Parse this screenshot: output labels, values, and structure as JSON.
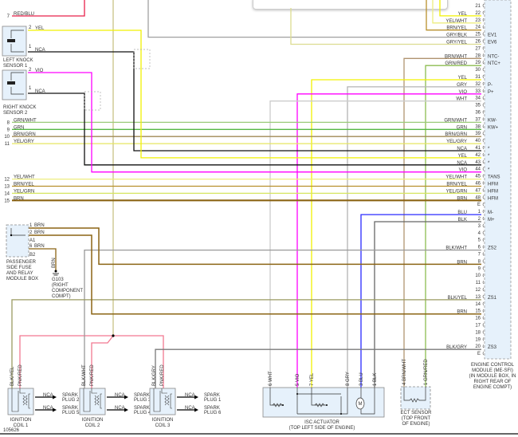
{
  "diagram_id": "105626",
  "ecm": {
    "label": [
      "ENGINE CONTROL",
      "MODULE (ME-SFI)",
      "(IN MODULE BOX, IN",
      "RIGHT REAR OF",
      "ENGINE COMPT)"
    ],
    "pins": [
      {
        "pin": "21",
        "wire": "",
        "func": "",
        "color": ""
      },
      {
        "pin": "22",
        "wire": "YEL",
        "func": "",
        "color": "#f2f200"
      },
      {
        "pin": "23",
        "wire": "YEL/WHT",
        "func": "",
        "color": "#eeee80"
      },
      {
        "pin": "24",
        "wire": "BRN/YEL",
        "func": "",
        "color": "#b8902c"
      },
      {
        "pin": "25",
        "wire": "GRY/BLK",
        "func": "EV1",
        "color": "#a0a0a0"
      },
      {
        "pin": "26",
        "wire": "GRY/YEL",
        "func": "EV6",
        "color": "#dcdc90"
      },
      {
        "pin": "27",
        "wire": "",
        "func": "",
        "color": ""
      },
      {
        "pin": "28",
        "wire": "BRN/WHT",
        "func": "NTC-",
        "color": "#b09470"
      },
      {
        "pin": "29",
        "wire": "GRN/RED",
        "func": "NTC+",
        "color": "#8cbc50"
      },
      {
        "pin": "30",
        "wire": "",
        "func": "",
        "color": ""
      },
      {
        "pin": "31",
        "wire": "YEL",
        "func": "",
        "color": "#f2f200"
      },
      {
        "pin": "32",
        "wire": "GRY",
        "func": "P-",
        "color": "#b4b4b4"
      },
      {
        "pin": "33",
        "wire": "VIO",
        "func": "P+",
        "color": "#ff00ff"
      },
      {
        "pin": "34",
        "wire": "WHT",
        "func": "",
        "color": "#cccccc"
      },
      {
        "pin": "35",
        "wire": "",
        "func": "",
        "color": ""
      },
      {
        "pin": "36",
        "wire": "",
        "func": "",
        "color": ""
      },
      {
        "pin": "37",
        "wire": "GRN/WHT",
        "func": "KW-",
        "color": "#9acb78"
      },
      {
        "pin": "38",
        "wire": "GRN",
        "func": "KW+",
        "color": "#55b845"
      },
      {
        "pin": "39",
        "wire": "BRN/GRN",
        "func": "",
        "color": "#a08a55"
      },
      {
        "pin": "40",
        "wire": "YEL/GRY",
        "func": "",
        "color": "#e6e660"
      },
      {
        "pin": "41",
        "wire": "NCA",
        "func": "*",
        "color": "#111111"
      },
      {
        "pin": "42",
        "wire": "YEL",
        "func": "*",
        "color": "#f2f200"
      },
      {
        "pin": "43",
        "wire": "NCA",
        "func": "*",
        "color": "#111111"
      },
      {
        "pin": "44",
        "wire": "VIO",
        "func": "*",
        "color": "#ff00ff"
      },
      {
        "pin": "45",
        "wire": "YEL/WHT",
        "func": "TANS",
        "color": "#eeee80"
      },
      {
        "pin": "46",
        "wire": "BRN/YEL",
        "func": "HFM",
        "color": "#b8902c"
      },
      {
        "pin": "47",
        "wire": "YEL/GRN",
        "func": "HFM",
        "color": "#d6e660"
      },
      {
        "pin": "48",
        "wire": "BRN",
        "func": "HFM",
        "color": "#8b6414"
      },
      {
        "pin": "E",
        "wire": "",
        "func": "",
        "color": ""
      },
      {
        "pin": "1",
        "wire": "BLU",
        "func": "M-",
        "color": "#2a2aff"
      },
      {
        "pin": "2",
        "wire": "BLK",
        "func": "M+",
        "color": "#666666"
      },
      {
        "pin": "3",
        "wire": "",
        "func": "",
        "color": ""
      },
      {
        "pin": "4",
        "wire": "",
        "func": "",
        "color": ""
      },
      {
        "pin": "5",
        "wire": "",
        "func": "",
        "color": ""
      },
      {
        "pin": "6",
        "wire": "BLK/WHT",
        "func": "ZS2",
        "color": "#999999"
      },
      {
        "pin": "7",
        "wire": "",
        "func": "",
        "color": ""
      },
      {
        "pin": "8",
        "wire": "BRN",
        "func": "",
        "color": "#8b6414"
      },
      {
        "pin": "9",
        "wire": "",
        "func": "",
        "color": ""
      },
      {
        "pin": "10",
        "wire": "",
        "func": "",
        "color": ""
      },
      {
        "pin": "11",
        "wire": "",
        "func": "",
        "color": ""
      },
      {
        "pin": "12",
        "wire": "",
        "func": "",
        "color": ""
      },
      {
        "pin": "13",
        "wire": "BLK/YEL",
        "func": "ZS1",
        "color": "#9a9a60"
      },
      {
        "pin": "14",
        "wire": "",
        "func": "",
        "color": ""
      },
      {
        "pin": "15",
        "wire": "BRN",
        "func": "",
        "color": "#8b6414"
      },
      {
        "pin": "16",
        "wire": "",
        "func": "",
        "color": ""
      },
      {
        "pin": "17",
        "wire": "",
        "func": "",
        "color": ""
      },
      {
        "pin": "18",
        "wire": "",
        "func": "",
        "color": ""
      },
      {
        "pin": "19",
        "wire": "",
        "func": "",
        "color": ""
      },
      {
        "pin": "20",
        "wire": "BLK/GRY",
        "func": "ZS3",
        "color": "#7a7a7a"
      },
      {
        "pin": "E",
        "wire": "",
        "func": "",
        "color": ""
      }
    ]
  },
  "left_connector": [
    {
      "pin": "7",
      "wire": "RED/BLU",
      "color": "#e8204a"
    },
    {
      "pin": "8",
      "wire": "GRN/WHT"
    },
    {
      "pin": "9",
      "wire": "GRN"
    },
    {
      "pin": "10",
      "wire": "BRN/GRN"
    },
    {
      "pin": "11",
      "wire": "YEL/GRY"
    },
    {
      "pin": "12",
      "wire": "YEL/WHT"
    },
    {
      "pin": "13",
      "wire": "BRN/YEL"
    },
    {
      "pin": "14",
      "wire": "YEL/GRN"
    },
    {
      "pin": "15",
      "wire": "BRN"
    }
  ],
  "knock_left": {
    "label": [
      "LEFT KNOCK",
      "SENSOR 1"
    ],
    "pin2": "2",
    "wire2": "YEL",
    "pin1": "1",
    "wire1": "NCA"
  },
  "knock_right": {
    "label": [
      "RIGHT KNOCK",
      "SENSOR 2"
    ],
    "pin2": "2",
    "wire2": "VIO",
    "pin1": "1",
    "wire1": "NCA"
  },
  "fuse_box": {
    "label": [
      "PASSENGER",
      "SIDE FUSE",
      "AND RELAY",
      "MODULE BOX"
    ],
    "pins": [
      {
        "pin": "1",
        "wire": "BRN"
      },
      {
        "pin": "2",
        "wire": "BRN"
      },
      {
        "pin": "6",
        "wire": "BRN"
      }
    ],
    "conn_a": "A1",
    "conn_b": "B2"
  },
  "ground": {
    "wire": "BRN",
    "label": [
      "G103",
      "(RIGHT",
      "COMPONENT",
      "COMPT)"
    ]
  },
  "coils": [
    {
      "label": [
        "IGNITION",
        "COIL 1"
      ],
      "wire_a": "BLK/YEL",
      "wire_b": "PNK/RED",
      "out": [
        {
          "wire": "NCA",
          "plug": [
            "SPARK",
            "PLUG 2"
          ]
        },
        {
          "wire": "NCA",
          "plug": [
            "SPARK",
            "PLUG 5"
          ]
        }
      ]
    },
    {
      "label": [
        "IGNITION",
        "COIL 2"
      ],
      "wire_a": "BLK/WHT",
      "wire_b": "PNK/RED",
      "out": [
        {
          "wire": "NCA",
          "plug": [
            "SPARK",
            "PLUG 3"
          ]
        },
        {
          "wire": "NCA",
          "plug": [
            "SPARK",
            "PLUG 4"
          ]
        }
      ]
    },
    {
      "label": [
        "IGNITION",
        "COIL 3"
      ],
      "wire_a": "BLK/GRY",
      "wire_b": "PNK/RED",
      "out": [
        {
          "wire": "NCA",
          "plug": [
            "SPARK",
            "PLUG 1"
          ]
        },
        {
          "wire": "NCA",
          "plug": [
            "SPARK",
            "PLUG 6"
          ]
        }
      ]
    }
  ],
  "isc": {
    "label": [
      "ISC ACTUATOR",
      "(TOP LEFT SIDE OF ENGINE)"
    ],
    "pins": [
      "6 WHT",
      "5 VIO",
      "7 YEL",
      "8 GRY",
      "3 BLU",
      "1 BLK"
    ],
    "motor": "M"
  },
  "ect": {
    "label": [
      "ECT SENSOR",
      "(TOP FRONT",
      "OF ENGINE)"
    ],
    "pins": [
      "4 BRN/WHT",
      "1 GRN/RED"
    ]
  },
  "colors": {
    "pnk_red": "#f27890",
    "olive": "#b8b060",
    "module_fill": "#e6f1fb"
  }
}
